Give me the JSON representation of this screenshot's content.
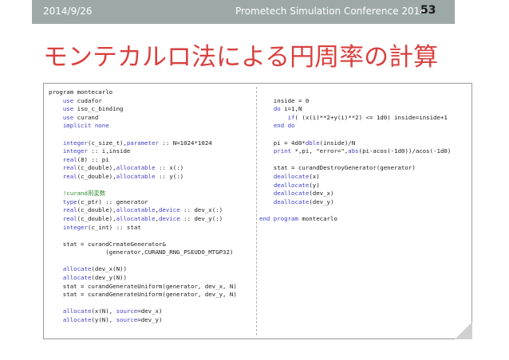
{
  "header": {
    "date": "2014/9/26",
    "conference": "Prometech Simulation Conference 2014",
    "page": "53"
  },
  "title": "モンテカルロ法による円周率の計算",
  "code": {
    "left": [
      [
        {
          "t": "program montecarlo"
        }
      ],
      [
        {
          "t": "    "
        },
        {
          "t": "use",
          "k": 1
        },
        {
          "t": " cudafor"
        }
      ],
      [
        {
          "t": "    "
        },
        {
          "t": "use",
          "k": 1
        },
        {
          "t": " iso_c_binding"
        }
      ],
      [
        {
          "t": "    "
        },
        {
          "t": "use",
          "k": 1
        },
        {
          "t": " curand"
        }
      ],
      [
        {
          "t": "    "
        },
        {
          "t": "implicit none",
          "k": 1
        }
      ],
      [
        {
          "t": ""
        }
      ],
      [
        {
          "t": "    "
        },
        {
          "t": "integer",
          "k": 1
        },
        {
          "t": "(c_size_t),"
        },
        {
          "t": "parameter",
          "k": 1
        },
        {
          "t": " :: N=1024*1024"
        }
      ],
      [
        {
          "t": "    "
        },
        {
          "t": "integer",
          "k": 1
        },
        {
          "t": " :: i,inside"
        }
      ],
      [
        {
          "t": "    "
        },
        {
          "t": "real",
          "k": 1
        },
        {
          "t": "(8) :: pi"
        }
      ],
      [
        {
          "t": "    "
        },
        {
          "t": "real",
          "k": 1
        },
        {
          "t": "(c_double),"
        },
        {
          "t": "allocatable",
          "k": 1
        },
        {
          "t": " :: x(:)"
        }
      ],
      [
        {
          "t": "    "
        },
        {
          "t": "real",
          "k": 1
        },
        {
          "t": "(c_double),"
        },
        {
          "t": "allocatable",
          "k": 1
        },
        {
          "t": " :: y(:)"
        }
      ],
      [
        {
          "t": ""
        }
      ],
      [
        {
          "t": "    "
        },
        {
          "t": "!curand用変数",
          "c": 1
        }
      ],
      [
        {
          "t": "    "
        },
        {
          "t": "type",
          "k": 1
        },
        {
          "t": "(c_ptr) :: generator"
        }
      ],
      [
        {
          "t": "    "
        },
        {
          "t": "real",
          "k": 1
        },
        {
          "t": "(c_double),"
        },
        {
          "t": "allocatable",
          "k": 1
        },
        {
          "t": ","
        },
        {
          "t": "device",
          "k": 1
        },
        {
          "t": " :: dev_x(:)"
        }
      ],
      [
        {
          "t": "    "
        },
        {
          "t": "real",
          "k": 1
        },
        {
          "t": "(c_double),"
        },
        {
          "t": "allocatable",
          "k": 1
        },
        {
          "t": ","
        },
        {
          "t": "device",
          "k": 1
        },
        {
          "t": " :: dev_y(:)"
        }
      ],
      [
        {
          "t": "    "
        },
        {
          "t": "integer",
          "k": 1
        },
        {
          "t": "(c_int) :: stat"
        }
      ],
      [
        {
          "t": ""
        }
      ],
      [
        {
          "t": "    stat = curandCreateGenerator&"
        }
      ],
      [
        {
          "t": "                (generator,CURAND_RNG_PSEUDO_MTGP32)"
        }
      ],
      [
        {
          "t": ""
        }
      ],
      [
        {
          "t": "    "
        },
        {
          "t": "allocate",
          "k": 1
        },
        {
          "t": "(dev_x(N))"
        }
      ],
      [
        {
          "t": "    "
        },
        {
          "t": "allocate",
          "k": 1
        },
        {
          "t": "(dev_y(N))"
        }
      ],
      [
        {
          "t": "    stat = curandGenerateUniform(generator, dev_x, N)"
        }
      ],
      [
        {
          "t": "    stat = curandGenerateUniform(generator, dev_y, N)"
        }
      ],
      [
        {
          "t": ""
        }
      ],
      [
        {
          "t": "    "
        },
        {
          "t": "allocate",
          "k": 1
        },
        {
          "t": "(x(N), "
        },
        {
          "t": "source",
          "k": 1
        },
        {
          "t": "=dev_x)"
        }
      ],
      [
        {
          "t": "    "
        },
        {
          "t": "allocate",
          "k": 1
        },
        {
          "t": "(y(N), "
        },
        {
          "t": "source",
          "k": 1
        },
        {
          "t": "=dev_y)"
        }
      ]
    ],
    "right": [
      [
        {
          "t": ""
        }
      ],
      [
        {
          "t": "    inside = 0"
        }
      ],
      [
        {
          "t": "    "
        },
        {
          "t": "do",
          "k": 1
        },
        {
          "t": " i=1,N"
        }
      ],
      [
        {
          "t": "        "
        },
        {
          "t": "if",
          "k": 1
        },
        {
          "t": "( (x(i)**2+y(i)**2) <= 1d0) inside=inside+1"
        }
      ],
      [
        {
          "t": "    "
        },
        {
          "t": "end do",
          "k": 1
        }
      ],
      [
        {
          "t": ""
        }
      ],
      [
        {
          "t": "    pi = 4d0*"
        },
        {
          "t": "dble",
          "k": 1
        },
        {
          "t": "(inside)/N"
        }
      ],
      [
        {
          "t": "    "
        },
        {
          "t": "print",
          "k": 1
        },
        {
          "t": " *,pi, \"error=\","
        },
        {
          "t": "abs",
          "k": 1
        },
        {
          "t": "(pi-acos(-1d0))/acos(-1d0)"
        }
      ],
      [
        {
          "t": ""
        }
      ],
      [
        {
          "t": "    stat = curandDestroyGenerator(generator)"
        }
      ],
      [
        {
          "t": "    "
        },
        {
          "t": "deallocate",
          "k": 1
        },
        {
          "t": "(x)"
        }
      ],
      [
        {
          "t": "    "
        },
        {
          "t": "deallocate",
          "k": 1
        },
        {
          "t": "(y)"
        }
      ],
      [
        {
          "t": "    "
        },
        {
          "t": "deallocate",
          "k": 1
        },
        {
          "t": "(dev_x)"
        }
      ],
      [
        {
          "t": "    "
        },
        {
          "t": "deallocate",
          "k": 1
        },
        {
          "t": "(dev_y)"
        }
      ],
      [
        {
          "t": ""
        }
      ],
      [
        {
          "t": "end program",
          "k": 1
        },
        {
          "t": " montecarlo"
        }
      ]
    ]
  }
}
